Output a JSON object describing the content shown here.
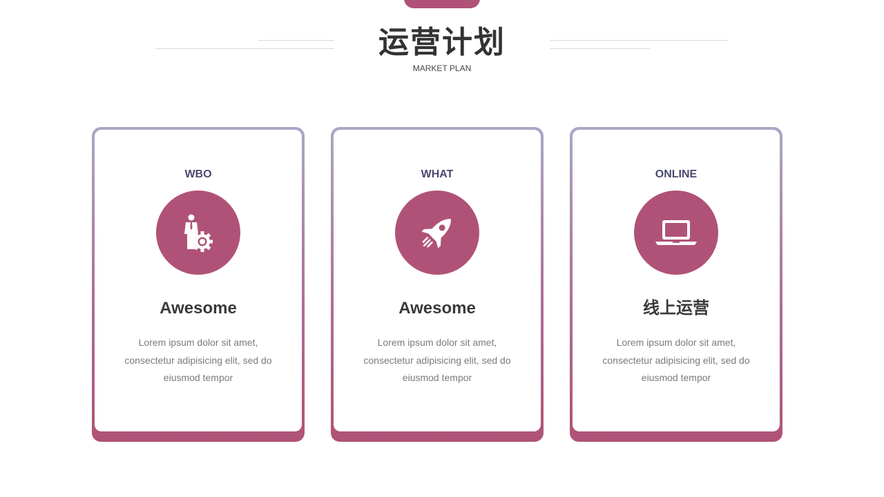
{
  "header": {
    "title": "运营计划",
    "subtitle": "MARKET PLAN"
  },
  "colors": {
    "accent": "#b05277",
    "label": "#4a4870",
    "gradient_top": "#aaa8c6"
  },
  "cards": [
    {
      "label": "WBO",
      "icon": "businessman-gear-icon",
      "heading": "Awesome",
      "body": "Lorem ipsum dolor sit amet, consectetur adipisicing elit, sed do eiusmod tempor"
    },
    {
      "label": "WHAT",
      "icon": "rocket-icon",
      "heading": "Awesome",
      "body": "Lorem ipsum dolor sit amet, consectetur adipisicing elit, sed do eiusmod tempor"
    },
    {
      "label": "ONLINE",
      "icon": "laptop-icon",
      "heading": "线上运营",
      "body": "Lorem ipsum dolor sit amet, consectetur adipisicing elit, sed do eiusmod tempor"
    }
  ]
}
